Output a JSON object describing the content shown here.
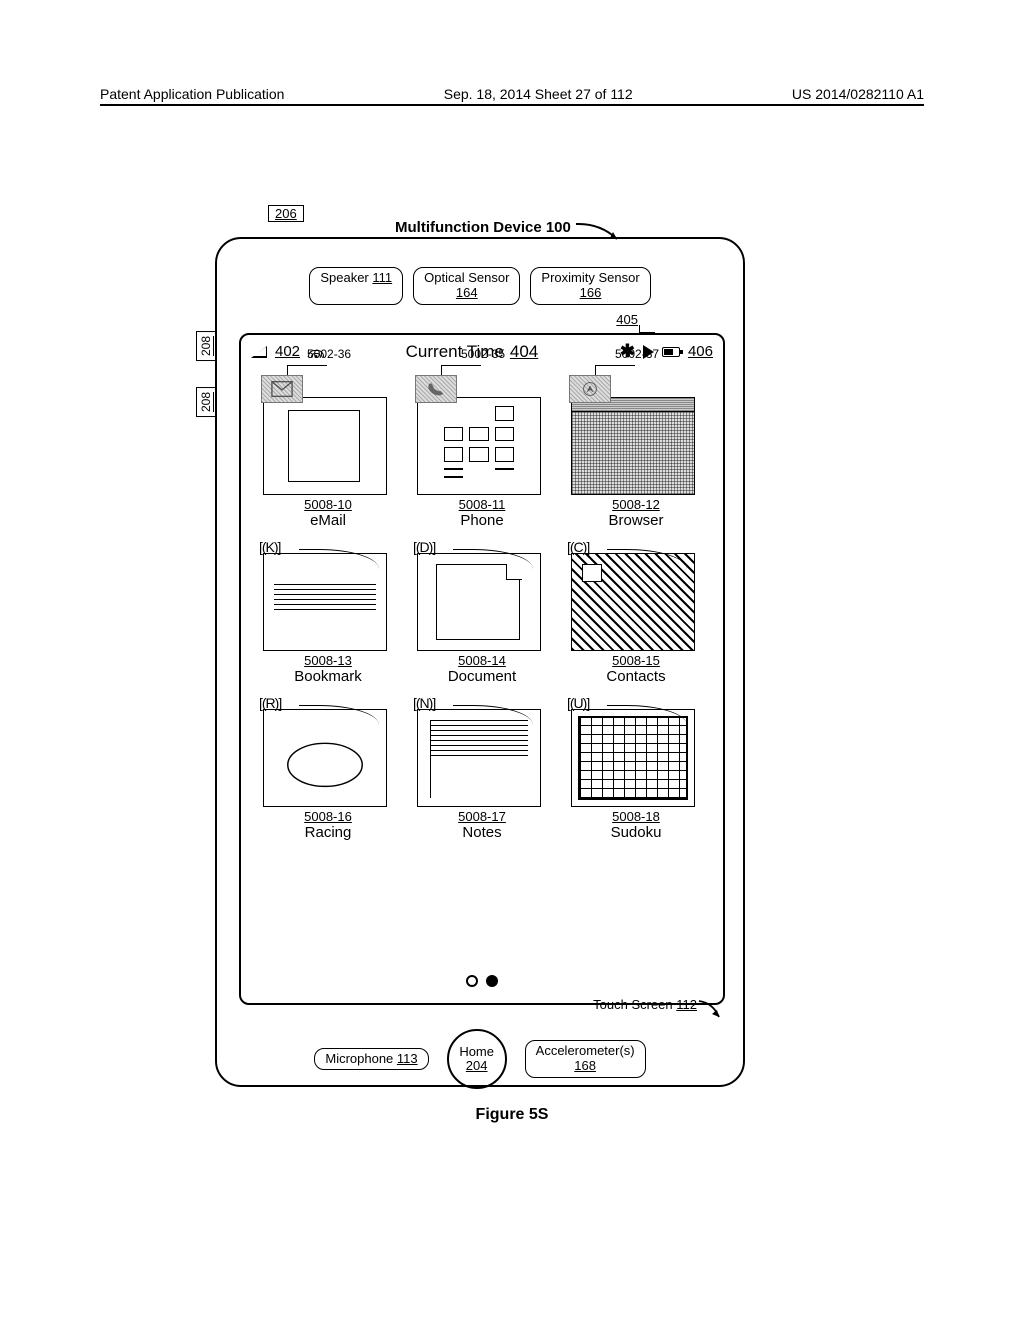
{
  "header": {
    "left": "Patent Application Publication",
    "center": "Sep. 18, 2014  Sheet 27 of 112",
    "right": "US 2014/0282110 A1"
  },
  "device": {
    "title": "Multifunction Device 100",
    "tag_206": "206",
    "tag_208a": "208",
    "tag_208b": "208",
    "speaker": {
      "label": "Speaker",
      "ref": "111"
    },
    "optical": {
      "label": "Optical Sensor",
      "ref": "164"
    },
    "proximity": {
      "label": "Proximity Sensor",
      "ref": "166"
    },
    "ref_405": "405"
  },
  "status": {
    "signal_ref": "402",
    "time_label": "Current Time",
    "time_ref": "404",
    "batt_ref": "406"
  },
  "badges": {
    "b1": {
      "ref": "5002-36"
    },
    "b2": {
      "ref": "5002-35"
    },
    "b3": {
      "ref": "5002-37"
    }
  },
  "row1": {
    "c1": {
      "num": "5008-10",
      "label": "eMail"
    },
    "c2": {
      "num": "5008-11",
      "label": "Phone"
    },
    "c3": {
      "num": "5008-12",
      "label": "Browser"
    }
  },
  "row2": {
    "c1": {
      "letter": "[(K)]",
      "num": "5008-13",
      "label": "Bookmark"
    },
    "c2": {
      "letter": "[(D)]",
      "num": "5008-14",
      "label": "Document"
    },
    "c3": {
      "letter": "[(C)]",
      "num": "5008-15",
      "label": "Contacts"
    }
  },
  "row3": {
    "c1": {
      "letter": "[(R)]",
      "num": "5008-16",
      "label": "Racing"
    },
    "c2": {
      "letter": "[(N)]",
      "num": "5008-17",
      "label": "Notes"
    },
    "c3": {
      "letter": "[(U)]",
      "num": "5008-18",
      "label": "Sudoku"
    }
  },
  "touchscreen": {
    "label": "Touch Screen",
    "ref": "112"
  },
  "mic": {
    "label": "Microphone",
    "ref": "113"
  },
  "home": {
    "label": "Home",
    "ref": "204"
  },
  "accel": {
    "label": "Accelerometer(s)",
    "ref": "168"
  },
  "figure": "Figure 5S"
}
